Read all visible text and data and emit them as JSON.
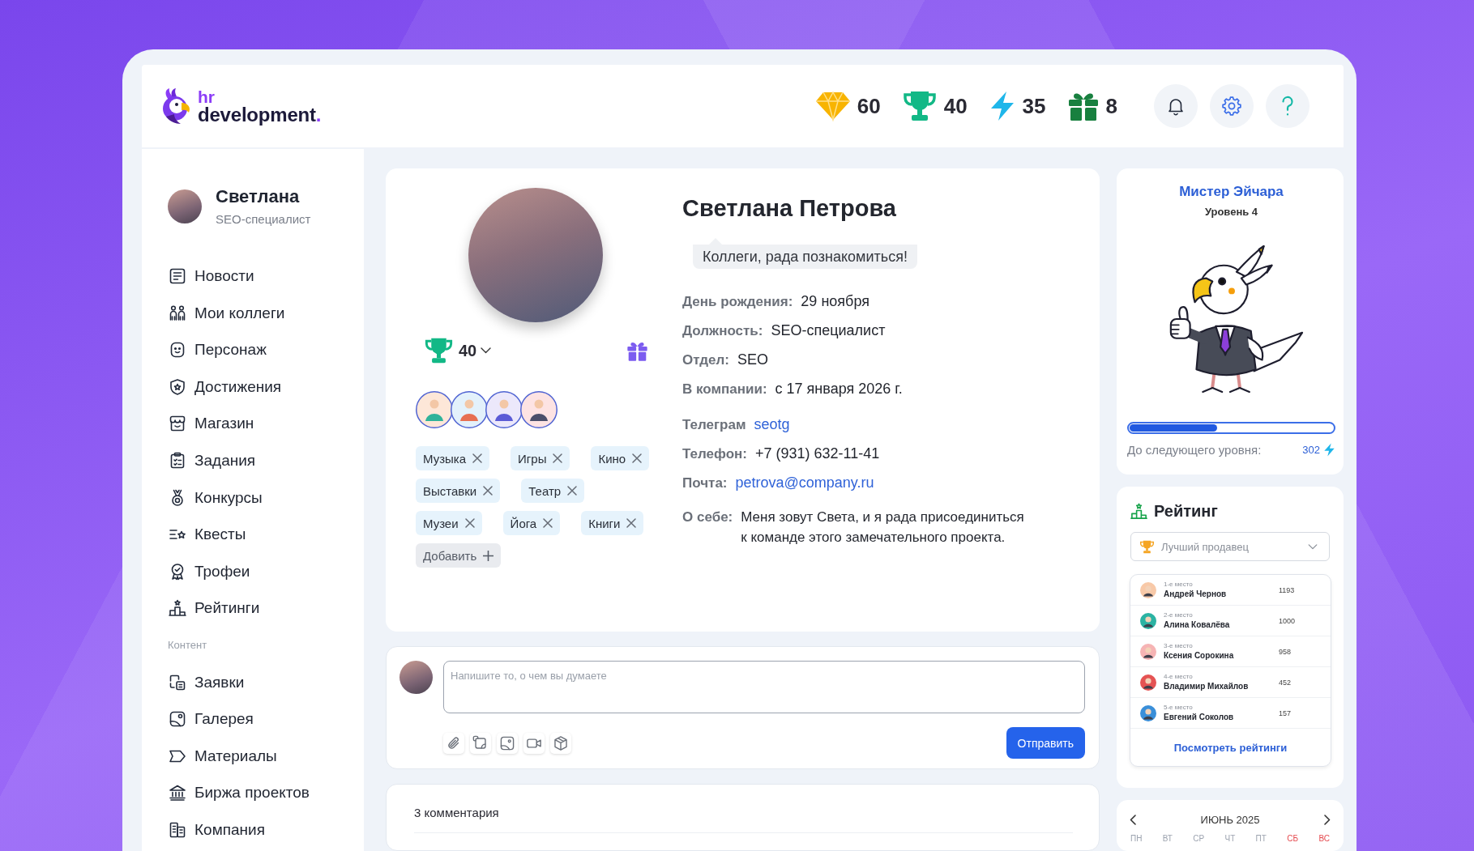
{
  "logo": {
    "hr": "hr",
    "name": "development",
    "dot": "."
  },
  "stats": [
    {
      "value": "60"
    },
    {
      "value": "40"
    },
    {
      "value": "35"
    },
    {
      "value": "8"
    }
  ],
  "user": {
    "name": "Светлана",
    "role": "SEO-специалист"
  },
  "sidebar": {
    "items": [
      {
        "kind": "link",
        "label": "Новости"
      },
      {
        "kind": "link",
        "label": "Мои коллеги"
      },
      {
        "kind": "link",
        "label": "Персонаж"
      },
      {
        "kind": "link",
        "label": "Достижения"
      },
      {
        "kind": "link",
        "label": "Магазин"
      },
      {
        "kind": "link",
        "label": "Задания"
      },
      {
        "kind": "link",
        "label": "Конкурсы"
      },
      {
        "kind": "link",
        "label": "Квесты"
      },
      {
        "kind": "link",
        "label": "Трофеи"
      },
      {
        "kind": "link",
        "label": "Рейтинги"
      },
      {
        "kind": "section",
        "label": "Контент"
      },
      {
        "kind": "link",
        "label": "Заявки"
      },
      {
        "kind": "link",
        "label": "Галерея"
      },
      {
        "kind": "link",
        "label": "Материалы"
      },
      {
        "kind": "link",
        "label": "Биржа проектов"
      },
      {
        "kind": "link",
        "label": "Компания"
      }
    ]
  },
  "profile": {
    "name": "Светлана Петрова",
    "status": "Коллеги, рада познакомиться!",
    "trophies": "40",
    "interests": [
      "Музыка",
      "Игры",
      "Кино",
      "Выставки",
      "Театр",
      "Музеи",
      "Йога",
      "Книги"
    ],
    "add_button": "Добавить",
    "details": [
      {
        "kind": "text",
        "label": "День рождения:",
        "value": "29 ноября"
      },
      {
        "kind": "text",
        "label": "Должность:",
        "value": "SEO-специалист"
      },
      {
        "kind": "text",
        "label": "Отдел:",
        "value": "SEO"
      },
      {
        "kind": "text",
        "label": "В компании:",
        "value": "с 17 января 2026 г."
      }
    ],
    "contacts": [
      {
        "kind": "link",
        "label": "Телеграм",
        "value": "seotg"
      },
      {
        "kind": "text",
        "label": "Телефон:",
        "value": "+7 (931) 632-11-41"
      },
      {
        "kind": "link",
        "label": "Почта:",
        "value": "petrova@company.ru"
      }
    ],
    "about": {
      "label": "О себе:",
      "value": "Меня зовут Света, и я рада присоединиться к команде этого замечательного проекта."
    }
  },
  "composer": {
    "placeholder": "Напишите то, о чем вы думаете",
    "send_button": "Отправить"
  },
  "comments": {
    "count": "3 комментария"
  },
  "mascot": {
    "name": "Мистер Эйчара",
    "level_label": "Уровень 4",
    "progress": {
      "level": 0.43
    },
    "next_label": "До следующего уровня:",
    "points": "302"
  },
  "rating": {
    "title": "Рейтинг",
    "select": {
      "value": "Лучший продавец"
    },
    "rows": [
      {
        "rank": "1-е место",
        "name": "Андрей Чернов",
        "score": "1193"
      },
      {
        "rank": "2-е место",
        "name": "Алина Ковалёва",
        "score": "1000"
      },
      {
        "rank": "3-е место",
        "name": "Ксения Сорокина",
        "score": "958"
      },
      {
        "rank": "4-е место",
        "name": "Владимир Михайлов",
        "score": "452"
      },
      {
        "rank": "5-е место",
        "name": "Евгений Соколов",
        "score": "157"
      }
    ],
    "link": "Посмотреть рейтинги"
  },
  "calendar": {
    "month": "ИЮНЬ 2025",
    "weekdays": [
      {
        "label": "ПН",
        "weekend": false
      },
      {
        "label": "ВТ",
        "weekend": false
      },
      {
        "label": "СР",
        "weekend": false
      },
      {
        "label": "ЧТ",
        "weekend": false
      },
      {
        "label": "ПТ",
        "weekend": false
      },
      {
        "label": "СБ",
        "weekend": true
      },
      {
        "label": "ВС",
        "weekend": true
      }
    ]
  }
}
